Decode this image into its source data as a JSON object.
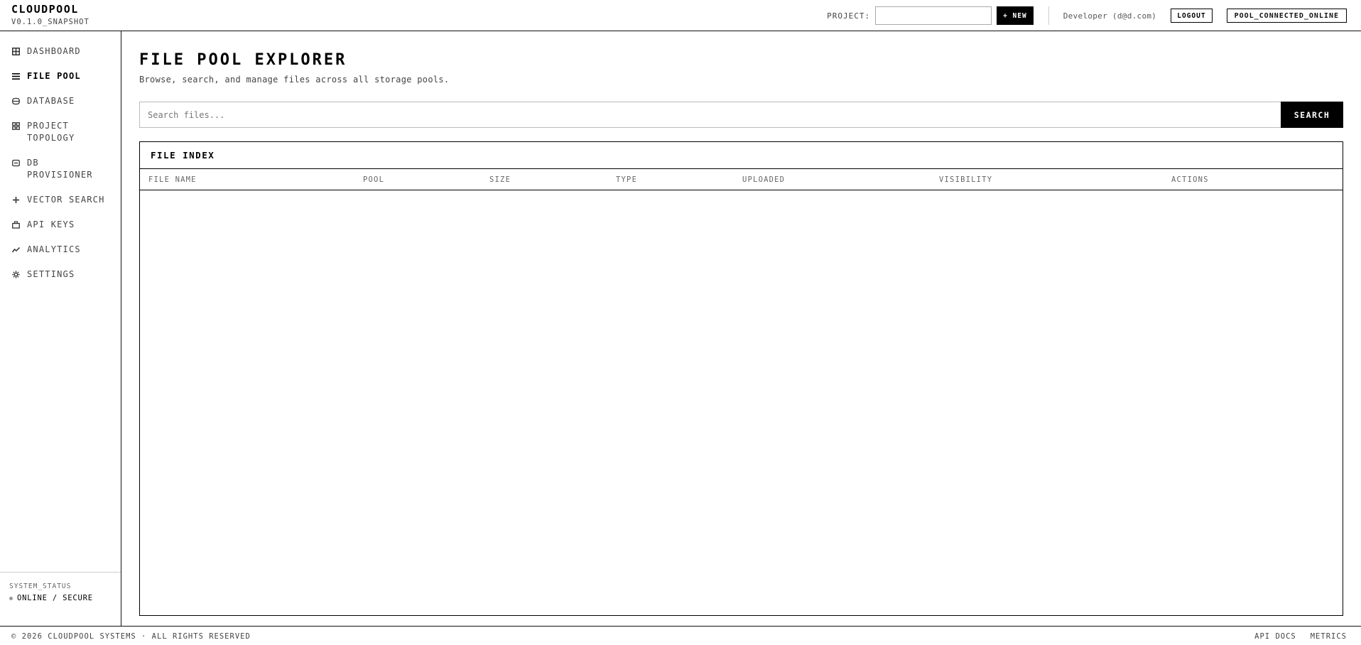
{
  "app": {
    "name": "CLOUDPOOL",
    "version": "V0.1.0_SNAPSHOT"
  },
  "header": {
    "project_label": "PROJECT:",
    "project_value": "",
    "new_label": "+ NEW",
    "user": "Developer (d@d.com)",
    "logout_label": "LOGOUT",
    "connection_status": "POOL_CONNECTED_ONLINE"
  },
  "sidebar": {
    "items": [
      {
        "label": "DASHBOARD",
        "icon": "grid-icon",
        "active": false
      },
      {
        "label": "FILE POOL",
        "icon": "list-icon",
        "active": true
      },
      {
        "label": "DATABASE",
        "icon": "database-icon",
        "active": false
      },
      {
        "label": "PROJECT TOPOLOGY",
        "icon": "topology-icon",
        "active": false
      },
      {
        "label": "DB PROVISIONER",
        "icon": "server-icon",
        "active": false
      },
      {
        "label": "VECTOR SEARCH",
        "icon": "plus-icon",
        "active": false
      },
      {
        "label": "API KEYS",
        "icon": "briefcase-icon",
        "active": false
      },
      {
        "label": "ANALYTICS",
        "icon": "trend-icon",
        "active": false
      },
      {
        "label": "SETTINGS",
        "icon": "gear-icon",
        "active": false
      }
    ],
    "system_status_label": "SYSTEM_STATUS",
    "system_status_value": "ONLINE / SECURE"
  },
  "main": {
    "title": "FILE POOL EXPLORER",
    "subtitle": "Browse, search, and manage files across all storage pools.",
    "search_placeholder": "Search files...",
    "search_value": "",
    "search_button": "SEARCH",
    "index_title": "FILE INDEX",
    "columns": [
      "FILE NAME",
      "POOL",
      "SIZE",
      "TYPE",
      "UPLOADED",
      "VISIBILITY",
      "ACTIONS"
    ],
    "rows": []
  },
  "footer": {
    "copyright": "© 2026 CLOUDPOOL SYSTEMS · ALL RIGHTS RESERVED",
    "links": [
      "API DOCS",
      "METRICS"
    ]
  }
}
